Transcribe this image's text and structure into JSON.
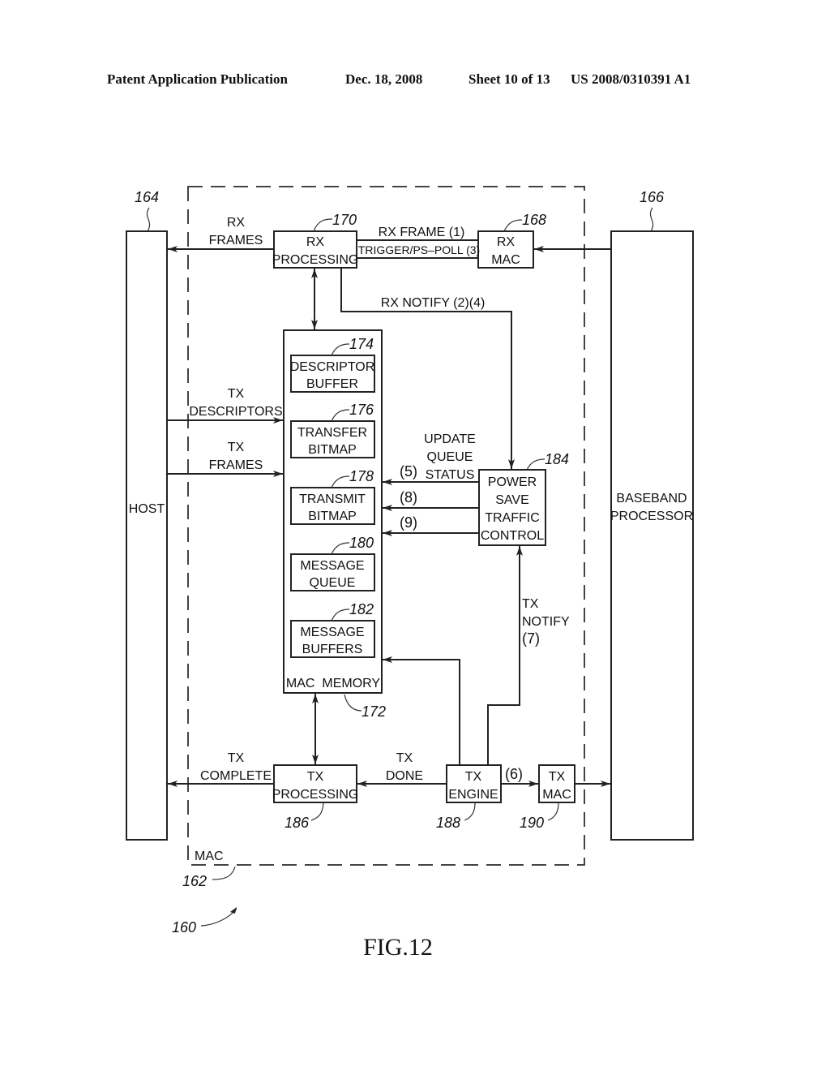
{
  "header": {
    "publication": "Patent Application Publication",
    "date": "Dec. 18, 2008",
    "sheet": "Sheet 10 of 13",
    "number": "US 2008/0310391 A1"
  },
  "figure": {
    "caption": "FIG.12",
    "ref_system": "160",
    "mac_boundary": {
      "label": "MAC",
      "ref": "162"
    },
    "blocks": {
      "host": {
        "label": "HOST",
        "ref": "164"
      },
      "baseband": {
        "line1": "BASEBAND",
        "line2": "PROCESSOR",
        "ref": "166"
      },
      "rx_mac": {
        "line1": "RX",
        "line2": "MAC",
        "ref": "168"
      },
      "rx_processing": {
        "line1": "RX",
        "line2": "PROCESSING",
        "ref": "170"
      },
      "mac_memory": {
        "label": "MAC  MEMORY",
        "ref": "172"
      },
      "descriptor_buffer": {
        "line1": "DESCRIPTOR",
        "line2": "BUFFER",
        "ref": "174"
      },
      "transfer_bitmap": {
        "line1": "TRANSFER",
        "line2": "BITMAP",
        "ref": "176"
      },
      "transmit_bitmap": {
        "line1": "TRANSMIT",
        "line2": "BITMAP",
        "ref": "178"
      },
      "message_queue": {
        "line1": "MESSAGE",
        "line2": "QUEUE",
        "ref": "180"
      },
      "message_buffers": {
        "line1": "MESSAGE",
        "line2": "BUFFERS",
        "ref": "182"
      },
      "ps_traffic_control": {
        "line1": "POWER",
        "line2": "SAVE",
        "line3": "TRAFFIC",
        "line4": "CONTROL",
        "ref": "184"
      },
      "tx_processing": {
        "line1": "TX",
        "line2": "PROCESSING",
        "ref": "186"
      },
      "tx_engine": {
        "line1": "TX",
        "line2": "ENGINE",
        "ref": "188"
      },
      "tx_mac": {
        "line1": "TX",
        "line2": "MAC",
        "ref": "190"
      }
    },
    "signals": {
      "rx_frames": {
        "line1": "RX",
        "line2": "FRAMES"
      },
      "rx_frame": "RX  FRAME  (1)",
      "trigger": "TRIGGER/PS–POLL  (3)",
      "rx_notify": "RX  NOTIFY  (2)(4)",
      "tx_descriptors": {
        "line1": "TX",
        "line2": "DESCRIPTORS"
      },
      "tx_frames": {
        "line1": "TX",
        "line2": "FRAMES"
      },
      "update_queue": {
        "line1": "UPDATE",
        "line2": "QUEUE",
        "line3": "STATUS"
      },
      "step5": "(5)",
      "step8": "(8)",
      "step9": "(9)",
      "tx_notify": {
        "line1": "TX",
        "line2": "NOTIFY",
        "line3": "(7)"
      },
      "tx_complete": {
        "line1": "TX",
        "line2": "COMPLETE"
      },
      "tx_done": {
        "line1": "TX",
        "line2": "DONE"
      },
      "step6": "(6)"
    }
  }
}
